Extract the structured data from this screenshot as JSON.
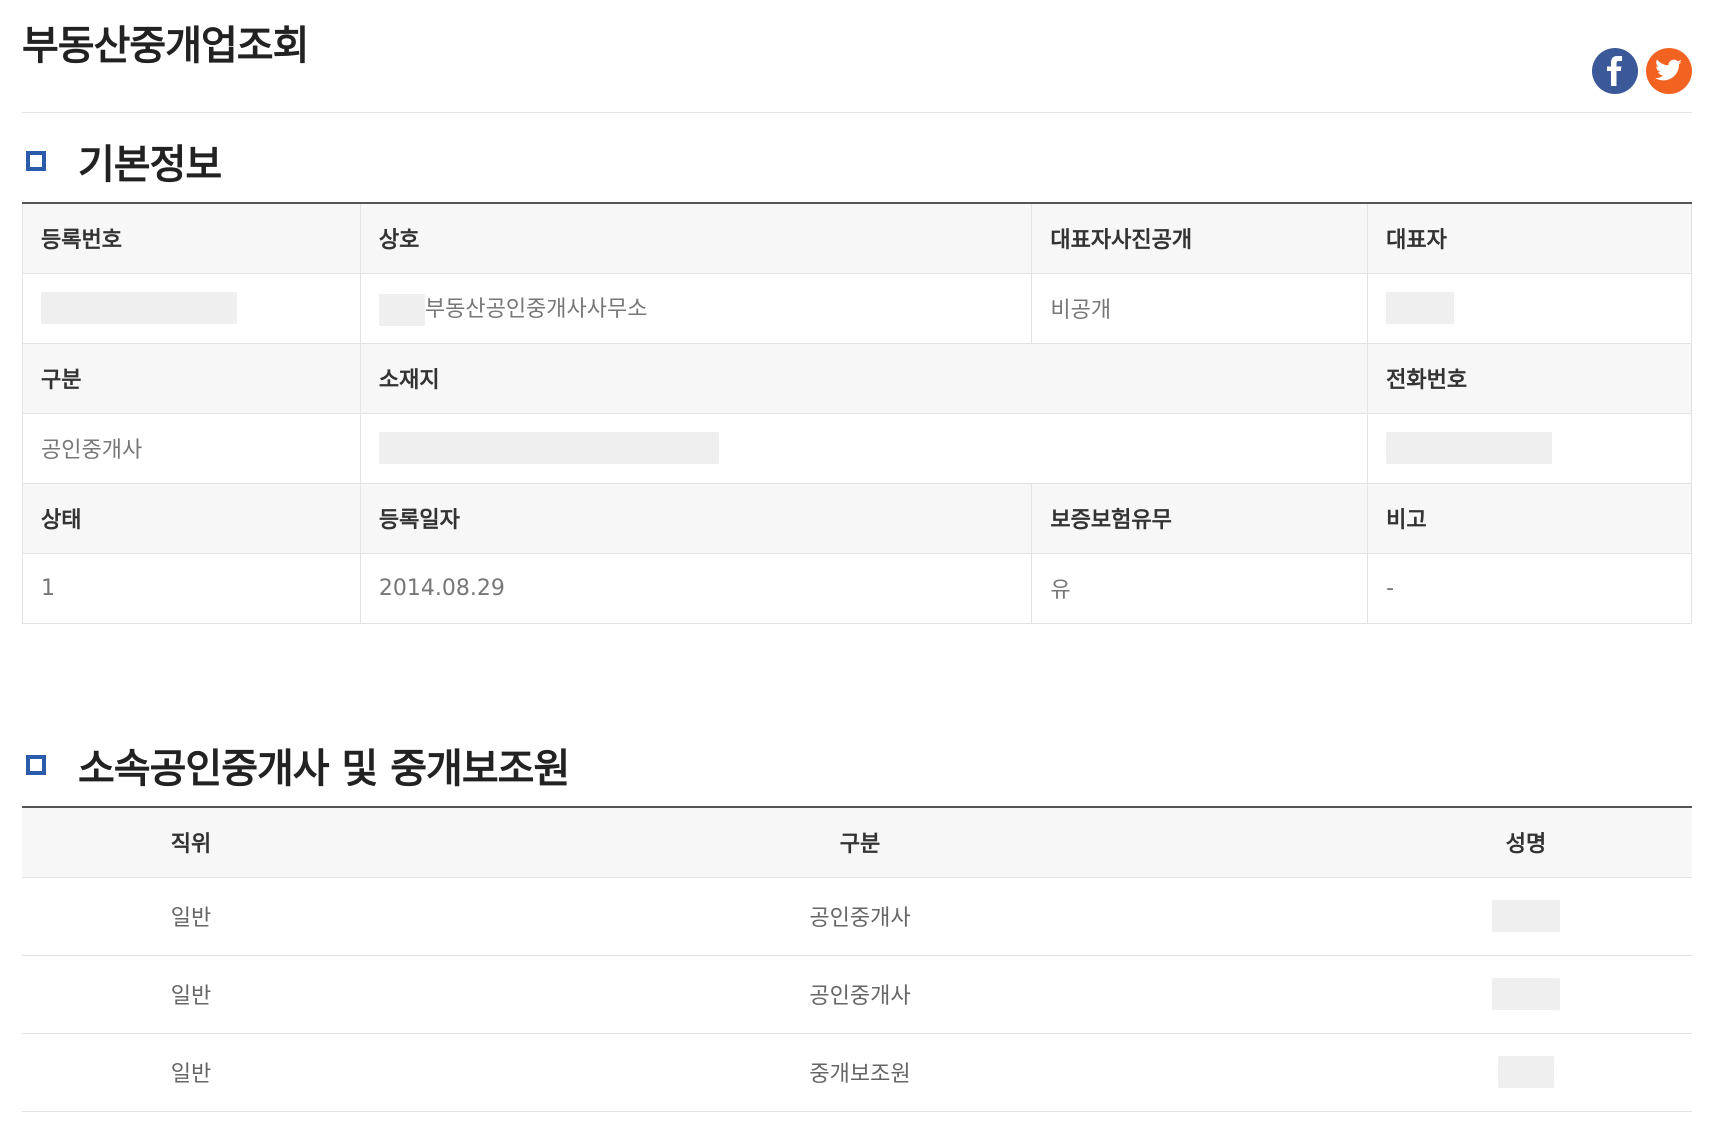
{
  "page": {
    "title": "부동산중개업조회"
  },
  "social": {
    "facebook_icon": "facebook-icon",
    "twitter_icon": "twitter-icon",
    "facebook_color": "#3b5998",
    "twitter_color": "#f26322"
  },
  "basic_info": {
    "heading": "기본정보",
    "labels": {
      "reg_no": "등록번호",
      "trade_name": "상호",
      "rep_photo": "대표자사진공개",
      "representative": "대표자",
      "category": "구분",
      "address": "소재지",
      "phone": "전화번호",
      "status": "상태",
      "reg_date": "등록일자",
      "insurance": "보증보험유무",
      "remarks": "비고"
    },
    "values": {
      "trade_name": "부동산공인중개사사무소",
      "rep_photo": "비공개",
      "category": "공인중개사",
      "status": "1",
      "reg_date": "2014.08.29",
      "insurance": "유",
      "remarks": "-"
    }
  },
  "members": {
    "heading": "소속공인중개사 및 중개보조원",
    "columns": [
      "직위",
      "구분",
      "성명"
    ],
    "rows": [
      {
        "position": "일반",
        "type": "공인중개사"
      },
      {
        "position": "일반",
        "type": "공인중개사"
      },
      {
        "position": "일반",
        "type": "중개보조원"
      }
    ]
  },
  "colors": {
    "accent": "#2a5caa",
    "header_bg": "#f7f7f7",
    "border": "#e3e3e3"
  }
}
